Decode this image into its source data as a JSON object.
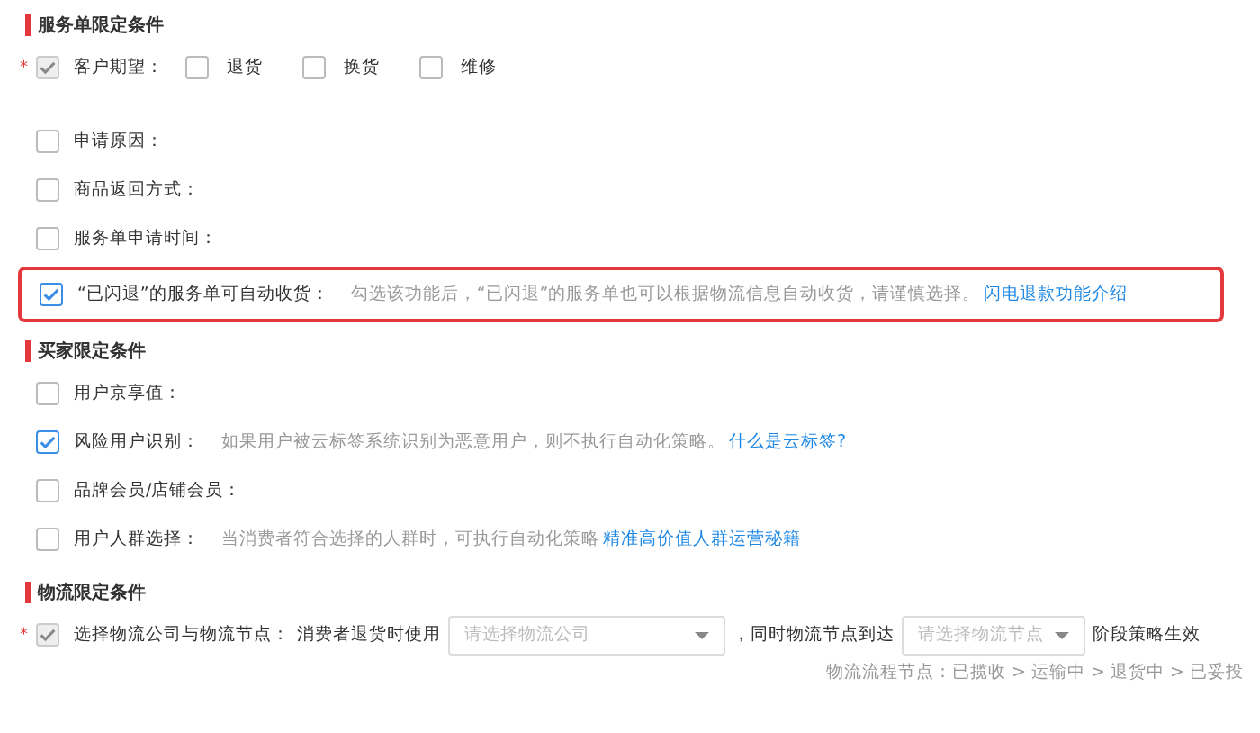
{
  "sections": [
    {
      "title": "服务单限定条件",
      "rows": [
        {
          "kind": "options",
          "required_mark": "*",
          "checked": true,
          "disabled": true,
          "label": "客户期望：",
          "options": [
            {
              "label": "退货",
              "checked": false
            },
            {
              "label": "换货",
              "checked": false
            },
            {
              "label": "维修",
              "checked": false
            }
          ]
        },
        {
          "kind": "check",
          "checked": false,
          "label": "申请原因："
        },
        {
          "kind": "check",
          "checked": false,
          "label": "商品返回方式："
        },
        {
          "kind": "check",
          "checked": false,
          "label": "服务单申请时间："
        },
        {
          "kind": "check",
          "checked": true,
          "highlighted": true,
          "label": "“已闪退”的服务单可自动收货：",
          "hint": "勾选该功能后，“已闪退”的服务单也可以根据物流信息自动收货，请谨慎选择。",
          "link": "闪电退款功能介绍"
        }
      ]
    },
    {
      "title": "买家限定条件",
      "rows": [
        {
          "kind": "check",
          "checked": false,
          "label": "用户京享值："
        },
        {
          "kind": "check",
          "checked": true,
          "label": "风险用户识别：",
          "hint": "如果用户被云标签系统识别为恶意用户，则不执行自动化策略。",
          "link": "什么是云标签?"
        },
        {
          "kind": "check",
          "checked": false,
          "label": "品牌会员/店铺会员："
        },
        {
          "kind": "check",
          "checked": false,
          "label": "用户人群选择：",
          "hint": "当消费者符合选择的人群时，可执行自动化策略",
          "link": "精准高价值人群运营秘籍"
        }
      ]
    },
    {
      "title": "物流限定条件",
      "rows": [
        {
          "kind": "logistics",
          "required_mark": "*",
          "checked": true,
          "disabled": true,
          "label": "选择物流公司与物流节点：",
          "prefix": "消费者退货时使用",
          "select1": {
            "placeholder": "请选择物流公司"
          },
          "middle": "，同时物流节点到达",
          "select2": {
            "placeholder": "请选择物流节点"
          },
          "suffix": "阶段策略生效",
          "note": "物流流程节点：已揽收 > 运输中 > 退货中 > 已妥投"
        }
      ]
    }
  ]
}
